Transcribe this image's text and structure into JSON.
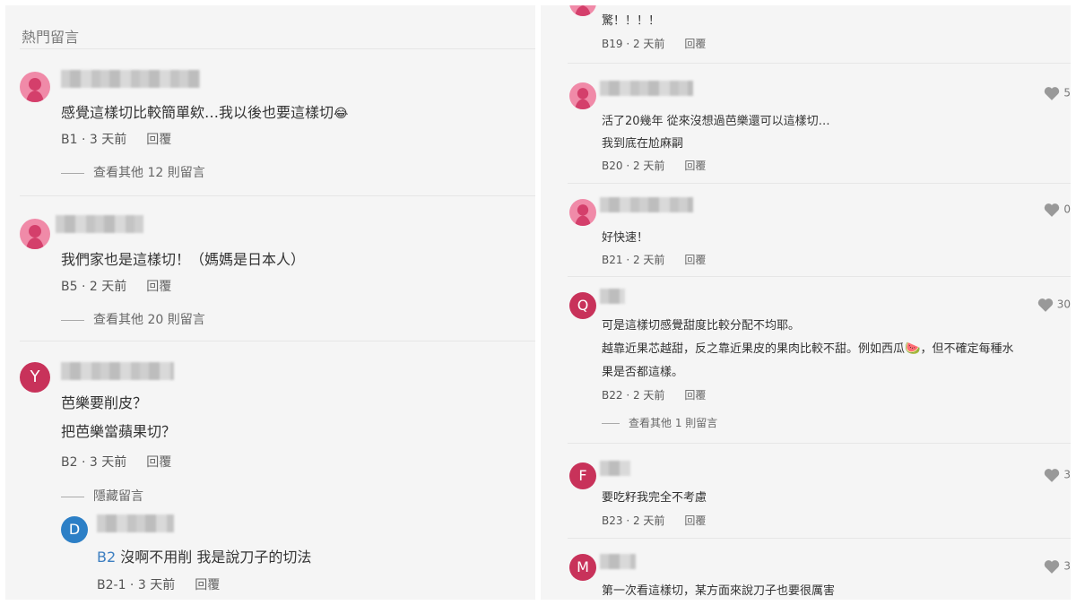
{
  "left_panel": {
    "section_title": "熱門留言",
    "comments": [
      {
        "avatar": "person-icon",
        "lines": [
          "感覺這樣切比較簡單欸…我以後也要這樣切"
        ],
        "emoji": "😂",
        "floor": "B1",
        "time": "3 天前",
        "reply": "回覆",
        "more": "查看其他 12 則留言"
      },
      {
        "avatar": "person-icon",
        "lines": [
          "我們家也是這樣切！（媽媽是日本人）"
        ],
        "floor": "B5",
        "time": "2 天前",
        "reply": "回覆",
        "more": "查看其他 20 則留言"
      },
      {
        "avatar_letter": "Y",
        "lines": [
          "芭樂要削皮？",
          "把芭樂當蘋果切？"
        ],
        "floor": "B2",
        "time": "3 天前",
        "reply": "回覆",
        "more": "隱藏留言"
      }
    ],
    "sub_reply": {
      "avatar_letter": "D",
      "ref": "B2",
      "text": "沒啊不用削 我是說刀子的切法",
      "floor": "B2-1",
      "time": "3 天前",
      "reply": "回覆"
    }
  },
  "right_panel": {
    "comments": [
      {
        "avatar": "person-icon",
        "lines": [
          "驚！！！！"
        ],
        "floor": "B19",
        "time": "2 天前",
        "reply": "回覆"
      },
      {
        "avatar": "person-icon",
        "lines": [
          "活了20幾年 從來沒想過芭樂還可以這樣切…",
          "我到底在尬麻𠻸"
        ],
        "floor": "B20",
        "time": "2 天前",
        "reply": "回覆",
        "likes": "5"
      },
      {
        "avatar": "person-icon",
        "lines": [
          "好快速！"
        ],
        "floor": "B21",
        "time": "2 天前",
        "reply": "回覆",
        "likes": "0"
      },
      {
        "avatar_letter": "Q",
        "lines": [
          "可是這樣切感覺甜度比較分配不均耶。",
          "越靠近果芯越甜，反之靠近果皮的果肉比較不甜。例如西瓜",
          "果是否都這樣。"
        ],
        "emoji": "🍉",
        "line2_tail": "，但不確定每種水",
        "floor": "B22",
        "time": "2 天前",
        "reply": "回覆",
        "likes": "30",
        "more": "查看其他 1 則留言"
      },
      {
        "avatar_letter": "F",
        "lines": [
          "要吃籽我完全不考慮"
        ],
        "floor": "B23",
        "time": "2 天前",
        "reply": "回覆",
        "likes": "3"
      },
      {
        "avatar_letter": "M",
        "lines": [
          "第一次看這樣切，某方面來說刀子也要很厲害"
        ],
        "likes": "3"
      }
    ]
  },
  "colors": {
    "pink_avatar": "#f08aa8",
    "letter_avatar": "#c8325a",
    "reply_avatar": "#2c7fc6",
    "link": "#3d7fc1"
  }
}
